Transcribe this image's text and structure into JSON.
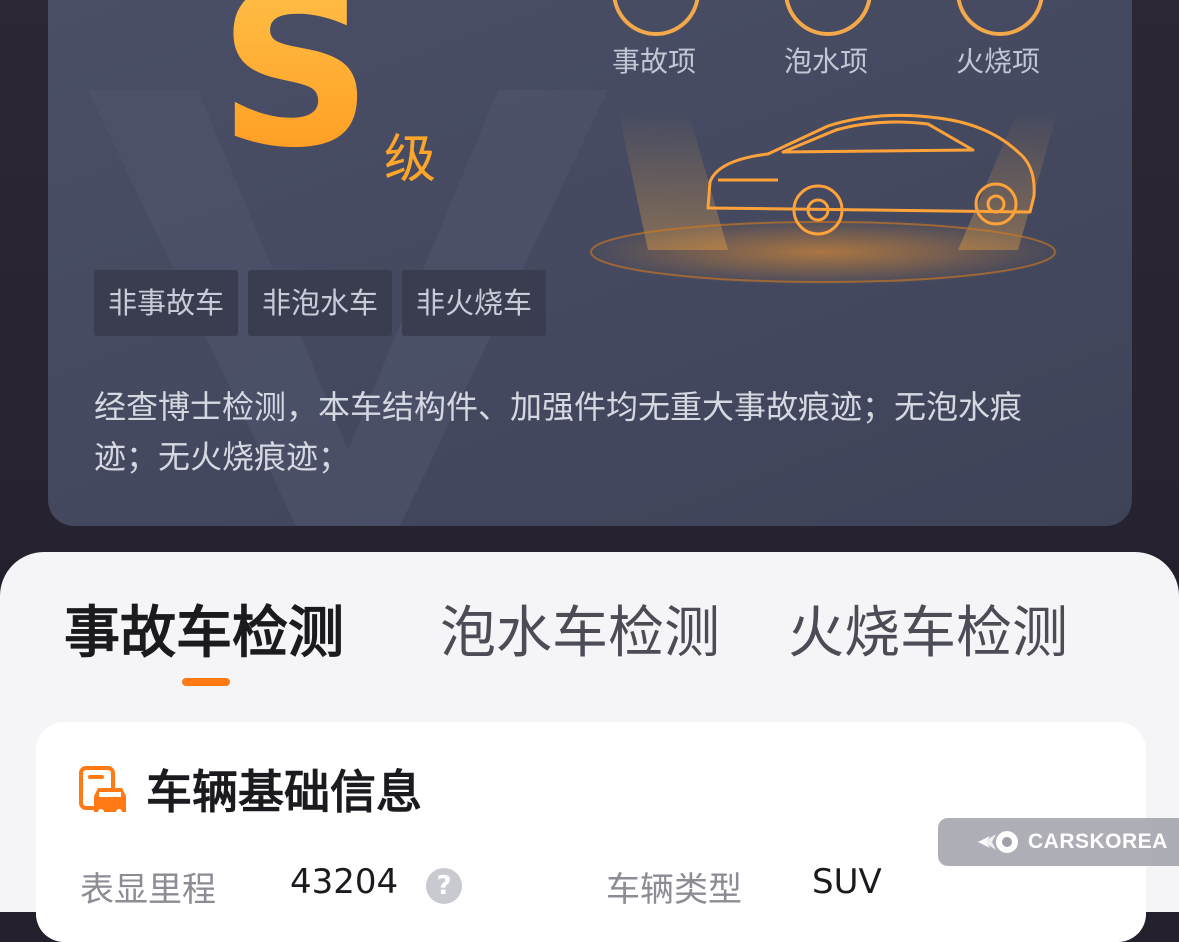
{
  "report": {
    "grade_letter": "S",
    "grade_suffix": "级",
    "check_items": [
      "事故项",
      "泡水项",
      "火烧项"
    ],
    "tags": [
      "非事故车",
      "非泡水车",
      "非火烧车"
    ],
    "summary": "经查博士检测，本车结构件、加强件均无重大事故痕迹；无泡水痕迹；无火烧痕迹；"
  },
  "tabs": [
    {
      "label": "事故车检测",
      "active": true
    },
    {
      "label": "泡水车检测",
      "active": false
    },
    {
      "label": "火烧车检测",
      "active": false
    }
  ],
  "info": {
    "title": "车辆基础信息",
    "fields": [
      {
        "label": "表显里程",
        "value": "43204"
      },
      {
        "label": "车辆类型",
        "value": "SUV"
      }
    ]
  },
  "watermark": {
    "text": "CARSKOREA"
  },
  "colors": {
    "accent": "#ff7a14",
    "grade": "#ffa629",
    "card": "#4a4f67"
  }
}
